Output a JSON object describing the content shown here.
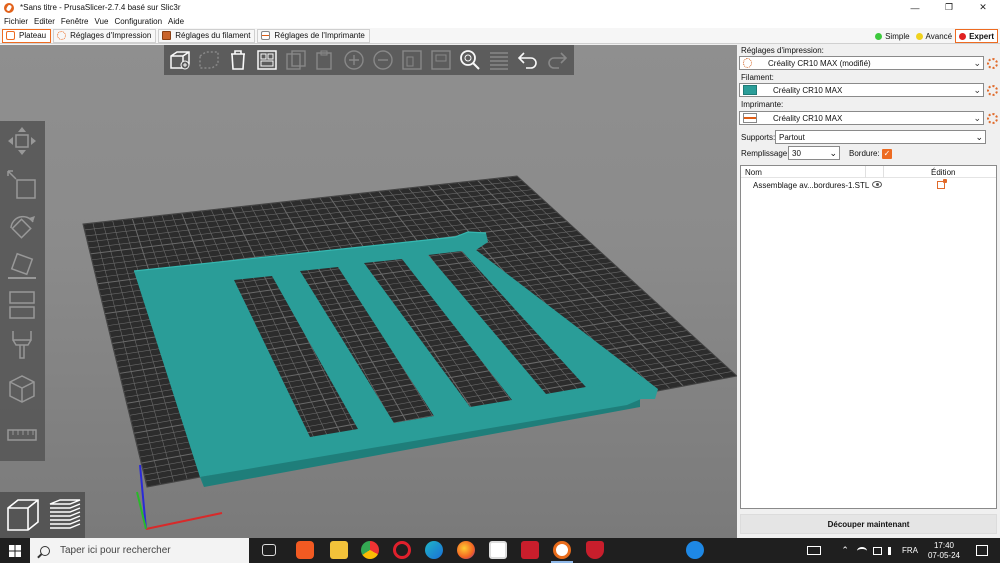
{
  "window": {
    "title": "*Sans titre - PrusaSlicer-2.7.4 basé sur Slic3r",
    "minimize_glyph": "—",
    "restore_glyph": "❐",
    "close_glyph": "✕"
  },
  "menu": [
    "Fichier",
    "Editer",
    "Fenêtre",
    "Vue",
    "Configuration",
    "Aide"
  ],
  "tabs": [
    {
      "label": "Plateau",
      "active": true
    },
    {
      "label": "Réglages d'Impression",
      "active": false
    },
    {
      "label": "Réglages du filament",
      "active": false
    },
    {
      "label": "Réglages de l'Imprimante",
      "active": false
    }
  ],
  "modes": [
    {
      "label": "Simple",
      "color": "#3dc93d",
      "active": false
    },
    {
      "label": "Avancé",
      "color": "#f0d21e",
      "active": false
    },
    {
      "label": "Expert",
      "color": "#e02020",
      "active": true
    }
  ],
  "sidebar": {
    "print_settings_label": "Réglages d'impression:",
    "print_settings_value": "Créality CR10 MAX (modifié)",
    "filament_label": "Filament:",
    "filament_value": "Créality CR10 MAX",
    "filament_color": "#2a9d98",
    "printer_label": "Imprimante:",
    "printer_value": "Créality CR10 MAX",
    "supports_label": "Supports:",
    "supports_value": "Partout",
    "infill_label": "Remplissage:",
    "infill_value": "30",
    "brim_label": "Bordure:",
    "brim_checked": true,
    "object_list": {
      "col_name": "Nom",
      "col_edit": "Édition",
      "objects": [
        {
          "name": "Assemblage av...bordures-1.STL"
        }
      ]
    },
    "slice_button": "Découper maintenant"
  },
  "scene": {
    "bed_color": "#2e2e2e",
    "grid_color": "#6a6a6a",
    "model_color": "#2a9d98",
    "model_side_color": "#1f7e7a"
  },
  "taskbar": {
    "search_placeholder": "Taper ici pour rechercher",
    "language": "FRA",
    "time": "17:40",
    "date": "07-05-24"
  }
}
